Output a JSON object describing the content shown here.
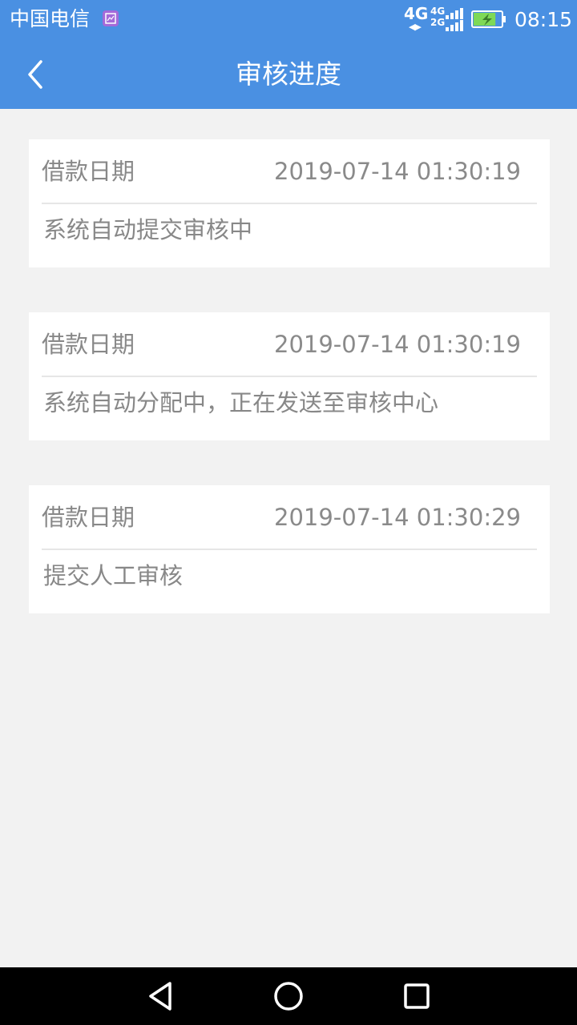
{
  "status_bar": {
    "carrier": "中国电信",
    "network_primary": "4G",
    "network_secondary_top": "4G",
    "network_secondary_bottom": "2G",
    "time": "08:15",
    "battery_level": 0.8,
    "battery_charging": true
  },
  "header": {
    "title": "审核进度",
    "back_icon": "chevron-left-icon"
  },
  "records": [
    {
      "label": "借款日期",
      "date": "2019-07-14 01:30:19",
      "status": "系统自动提交审核中"
    },
    {
      "label": "借款日期",
      "date": "2019-07-14 01:30:19",
      "status": "系统自动分配中，正在发送至审核中心"
    },
    {
      "label": "借款日期",
      "date": "2019-07-14 01:30:29",
      "status": "提交人工审核"
    }
  ],
  "nav_bar": {
    "back_icon": "triangle-back-icon",
    "home_icon": "circle-home-icon",
    "recents_icon": "square-recents-icon"
  },
  "colors": {
    "brand": "#4a90e2",
    "background": "#f2f2f2",
    "card": "#ffffff",
    "text_secondary": "#888888",
    "divider": "#e6e6e6",
    "badge": "#a46ad9"
  }
}
